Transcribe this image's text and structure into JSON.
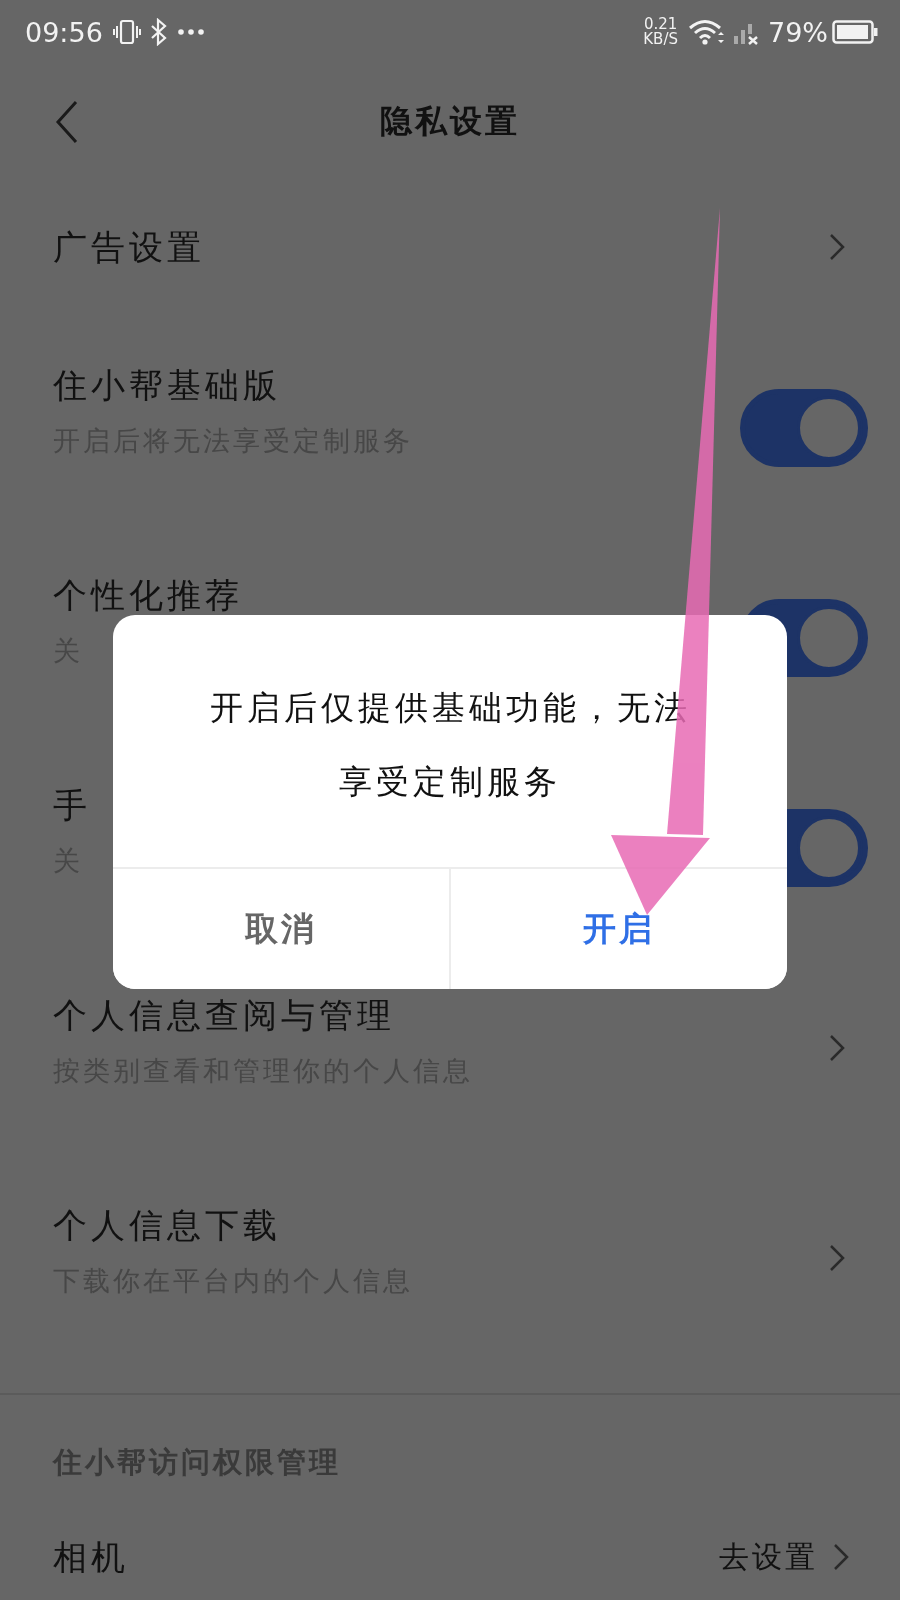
{
  "status_bar": {
    "time": "09:56",
    "net_speed": "0.21",
    "net_unit": "KB/S",
    "battery": "79%"
  },
  "header": {
    "title": "隐私设置"
  },
  "rows": [
    {
      "kind": "link",
      "title": "广告设置"
    },
    {
      "kind": "toggle",
      "title": "住小帮基础版",
      "subtitle": "开启后将无法享受定制服务",
      "on": true
    },
    {
      "kind": "toggle",
      "title": "个性化推荐",
      "subtitle": "关",
      "on": true
    },
    {
      "kind": "toggle",
      "title": "手",
      "subtitle": "关",
      "on": true
    },
    {
      "kind": "link",
      "title": "个人信息查阅与管理",
      "subtitle": "按类别查看和管理你的个人信息"
    },
    {
      "kind": "link",
      "title": "个人信息下载",
      "subtitle": "下载你在平台内的个人信息"
    }
  ],
  "section": {
    "title": "住小帮访问权限管理",
    "rows": [
      {
        "title": "相机",
        "action": "去设置"
      }
    ]
  },
  "dialog": {
    "message": "开启后仅提供基础功能，无法享受定制服务",
    "buttons": [
      {
        "label": "取消",
        "kind": "cancel"
      },
      {
        "label": "开启",
        "kind": "confirm"
      }
    ]
  }
}
